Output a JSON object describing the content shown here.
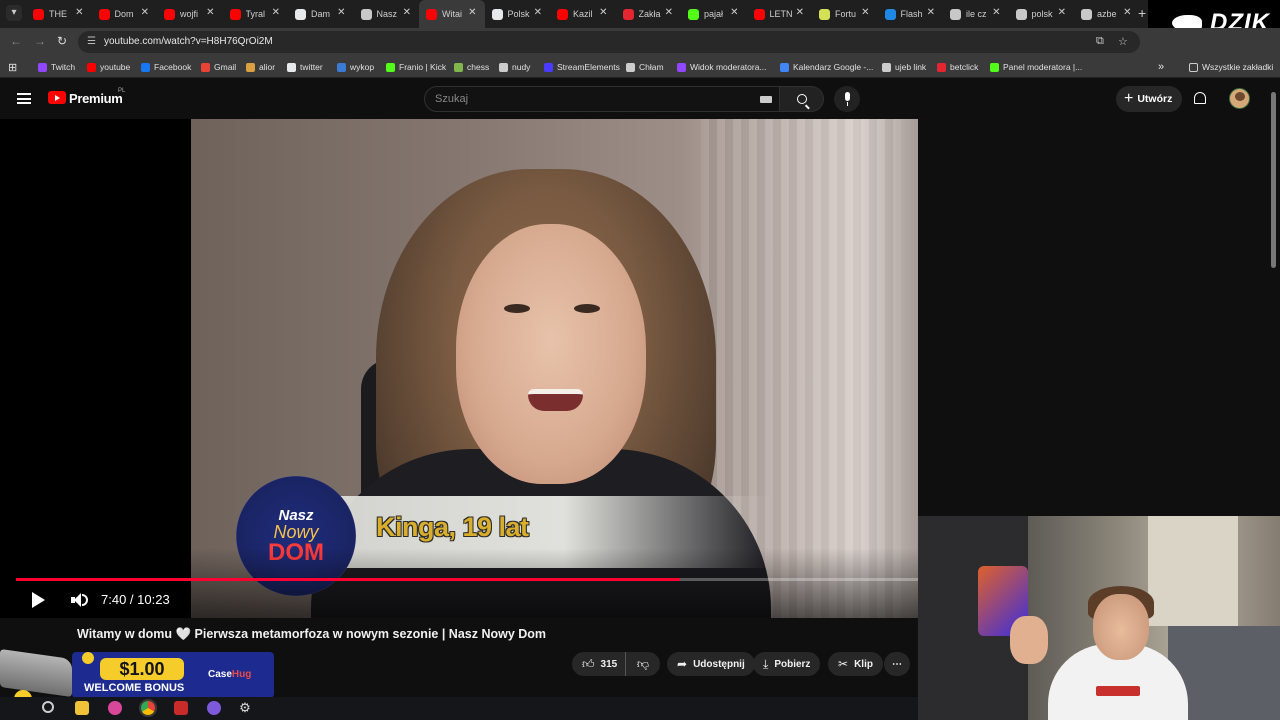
{
  "browser": {
    "tabs": [
      {
        "label": "THE",
        "favicon_color": "#ff0000"
      },
      {
        "label": "Dom",
        "favicon_color": "#ff0000"
      },
      {
        "label": "wojfi",
        "favicon_color": "#ff0000"
      },
      {
        "label": "Tyral",
        "favicon_color": "#ff0000"
      },
      {
        "label": "Dam",
        "favicon_color": "#e7e9ea"
      },
      {
        "label": "Nasz",
        "favicon_color": "#c8c8c8"
      },
      {
        "label": "Witai",
        "favicon_color": "#ff0000"
      },
      {
        "label": "Polsk",
        "favicon_color": "#e7e9ea"
      },
      {
        "label": "Kazil",
        "favicon_color": "#ff0000"
      },
      {
        "label": "Zakła",
        "favicon_color": "#e3262f"
      },
      {
        "label": "pajał",
        "favicon_color": "#53fc18"
      },
      {
        "label": "LETN",
        "favicon_color": "#ff0000"
      },
      {
        "label": "Fortu",
        "favicon_color": "#d4e157"
      },
      {
        "label": "Flash",
        "favicon_color": "#1e88e5"
      },
      {
        "label": "ile cz",
        "favicon_color": "#c8c8c8"
      },
      {
        "label": "polsk",
        "favicon_color": "#c8c8c8"
      },
      {
        "label": "azbe",
        "favicon_color": "#c8c8c8"
      }
    ],
    "active_tab_index": 6,
    "close_glyph": "✕",
    "new_tab_glyph": "+",
    "url": "youtube.com/watch?v=H8H76QrOi2M",
    "bookmarks": [
      {
        "label": "Twitch",
        "color": "#9146ff"
      },
      {
        "label": "youtube",
        "color": "#ff0000"
      },
      {
        "label": "Facebook",
        "color": "#1877f2"
      },
      {
        "label": "Gmail",
        "color": "#ea4335"
      },
      {
        "label": "alior",
        "color": "#d8a040"
      },
      {
        "label": "twitter",
        "color": "#e7e9ea"
      },
      {
        "label": "wykop",
        "color": "#3a7bd5"
      },
      {
        "label": "Franio | Kick",
        "color": "#53fc18"
      },
      {
        "label": "chess",
        "color": "#81b64c"
      },
      {
        "label": "nudy",
        "color": "#cccccc"
      },
      {
        "label": "StreamElements",
        "color": "#4a3aff"
      },
      {
        "label": "Chłam",
        "color": "#cccccc"
      },
      {
        "label": "Widok moderatora...",
        "color": "#9146ff"
      },
      {
        "label": "Kalendarz Google -...",
        "color": "#4285f4"
      },
      {
        "label": "ujeb link",
        "color": "#cccccc"
      },
      {
        "label": "betclick",
        "color": "#e3262f"
      },
      {
        "label": "Panel moderatora |...",
        "color": "#53fc18"
      }
    ],
    "all_bookmarks_label": "Wszystkie zakładki",
    "overlay_brand": "DZIK"
  },
  "youtube": {
    "logo_text": "Premium",
    "region_badge": "PL",
    "search_placeholder": "Szukaj",
    "create_label": "Utwórz",
    "accent_color": "#ff0000"
  },
  "player": {
    "current_time": "7:40",
    "duration": "10:23",
    "time_display": "7:40 / 10:23",
    "progress_fraction": 0.736,
    "lower_third_text": "Kinga, 19 lat",
    "show_logo": [
      "Nasz",
      "Nowy",
      "DOM"
    ],
    "progress_color": "#ff0033"
  },
  "video": {
    "title": "Witamy w domu 🤍 Pierwsza metamorfoza w nowym sezonie | Nasz Nowy Dom",
    "likes": "315",
    "share_label": "Udostępnij",
    "download_label": "Pobierz",
    "clip_label": "Klip",
    "more_glyph": "⋯"
  },
  "ad": {
    "price": "$1.00",
    "text": "WELCOME BONUS",
    "brand_prefix": "Case",
    "brand_suffix": "Hug"
  }
}
